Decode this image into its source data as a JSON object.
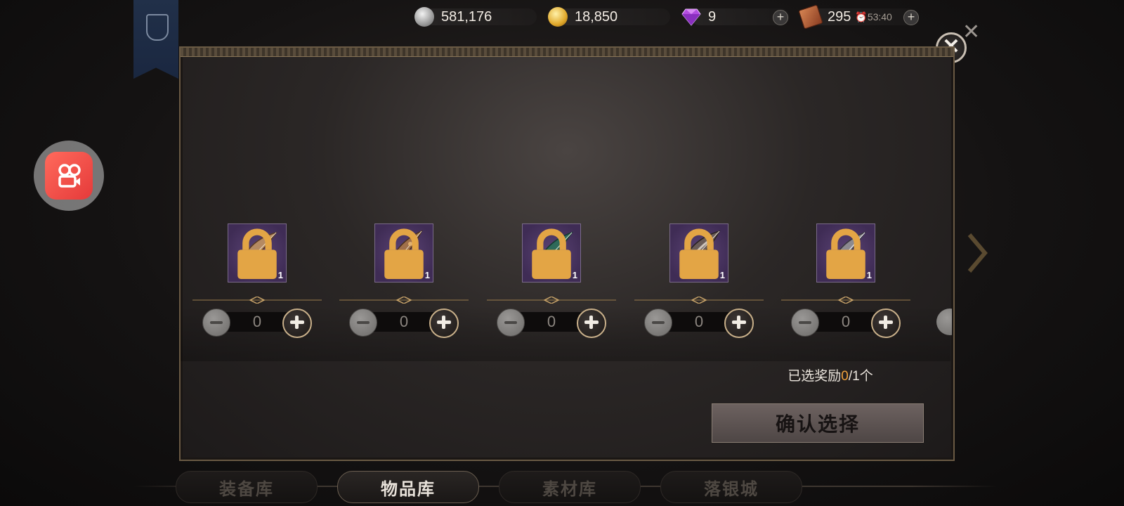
{
  "currencies": {
    "silver": {
      "value": "581,176",
      "icon": "silver-coin-icon"
    },
    "gold": {
      "value": "18,850",
      "icon": "gold-coin-icon"
    },
    "gem": {
      "value": "9",
      "icon": "diamond-icon"
    },
    "stamina": {
      "value": "295",
      "timer": "53:40",
      "icon": "book-icon"
    }
  },
  "panel": {
    "items": [
      {
        "qty": "1",
        "count": "0",
        "icon": "bow-icon"
      },
      {
        "qty": "1",
        "count": "0",
        "icon": "bow-icon"
      },
      {
        "qty": "1",
        "count": "0",
        "icon": "bow-icon"
      },
      {
        "qty": "1",
        "count": "0",
        "icon": "bow-icon"
      },
      {
        "qty": "1",
        "count": "0",
        "icon": "bow-icon"
      }
    ],
    "selected_prefix": "已选奖励",
    "selected_count": "0",
    "selected_suffix": "/1个",
    "confirm_label": "确认选择"
  },
  "tabs": [
    "装备库",
    "物品库",
    "素材库",
    "落银城"
  ],
  "active_tab": "物品库",
  "colors": {
    "accent": "#f0a13c",
    "item_bg": "#4a3563",
    "frame": "#6a5a44"
  }
}
